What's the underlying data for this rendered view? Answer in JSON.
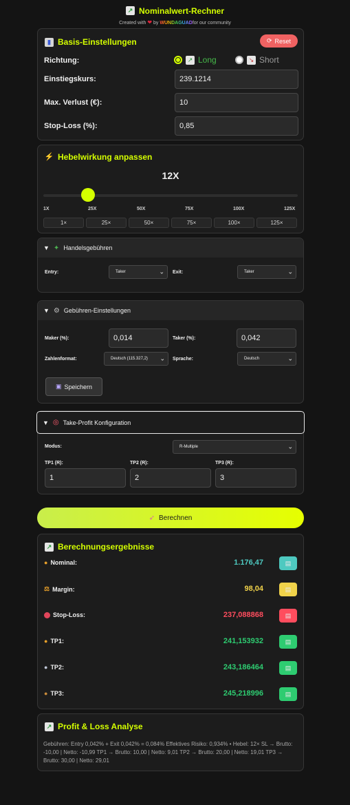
{
  "header": {
    "title": "Nominalwert-Rechner",
    "title_icon": "chart-up-icon",
    "sub_prefix": "Created with",
    "sub_by": "by",
    "brand": "WUNDAGUAD",
    "sub_suffix": "for our community"
  },
  "basis": {
    "title": "Basis-Einstellungen",
    "reset_label": "Reset",
    "direction_label": "Richtung:",
    "long_label": "Long",
    "short_label": "Short",
    "entry_label": "Einstiegskurs:",
    "entry_value": "239.1214",
    "maxloss_label": "Max. Verlust (€):",
    "maxloss_value": "10",
    "stoploss_label": "Stop-Loss (%):",
    "stoploss_value": "0,85"
  },
  "leverage": {
    "title": "Hebelwirkung anpassen",
    "value_label": "12X",
    "value": 12,
    "min": 1,
    "max": 125,
    "ticks": [
      "1X",
      "25X",
      "50X",
      "75X",
      "100X",
      "125X"
    ],
    "presets": [
      "1×",
      "25×",
      "50×",
      "75×",
      "100×",
      "125×"
    ]
  },
  "fees": {
    "title": "Handelsgebühren",
    "entry_label": "Entry:",
    "entry_value": "Taker",
    "exit_label": "Exit:",
    "exit_value": "Taker"
  },
  "fee_settings": {
    "title": "Gebühren-Einstellungen",
    "maker_label": "Maker (%):",
    "maker_value": "0,014",
    "taker_label": "Taker (%):",
    "taker_value": "0,042",
    "numfmt_label": "Zahlenformat:",
    "numfmt_value": "Deutsch (115.327,2)",
    "lang_label": "Sprache:",
    "lang_value": "Deutsch",
    "save_label": "Speichern"
  },
  "tp": {
    "title": "Take-Profit Konfiguration",
    "mode_label": "Modus:",
    "mode_value": "R-Multiple",
    "tp1_label": "TP1 (R):",
    "tp1_value": "1",
    "tp2_label": "TP2 (R):",
    "tp2_value": "2",
    "tp3_label": "TP3 (R):",
    "tp3_value": "3"
  },
  "calc_label": "Berechnen",
  "results": {
    "title": "Berechnungsergebnisse",
    "nominal_label": "Nominal:",
    "nominal_value": "1.176,47",
    "margin_label": "Margin:",
    "margin_value": "98,04",
    "sl_label": "Stop-Loss:",
    "sl_value": "237,088868",
    "tp1_label": "TP1:",
    "tp1_value": "241,153932",
    "tp2_label": "TP2:",
    "tp2_value": "243,186464",
    "tp3_label": "TP3:",
    "tp3_value": "245,218996"
  },
  "pl": {
    "title": "Profit & Loss Analyse",
    "text": "Gebühren: Entry 0,042% + Exit 0,042% = 0,084% Effektives Risiko: 0,934% • Hebel: 12× SL → Brutto: -10,00 | Netto: -10,99 TP1 → Brutto: 10,00 | Netto: 9,01 TP2 → Brutto: 20,00 | Netto: 19,01 TP3 → Brutto: 30,00 | Netto: 29,01"
  },
  "colors": {
    "accent": "#d4ff00",
    "nominal": "#4ec9c0",
    "margin": "#f0d24a",
    "stoploss": "#ff4d5e",
    "profit": "#2ecc71",
    "reset": "#f06262"
  }
}
